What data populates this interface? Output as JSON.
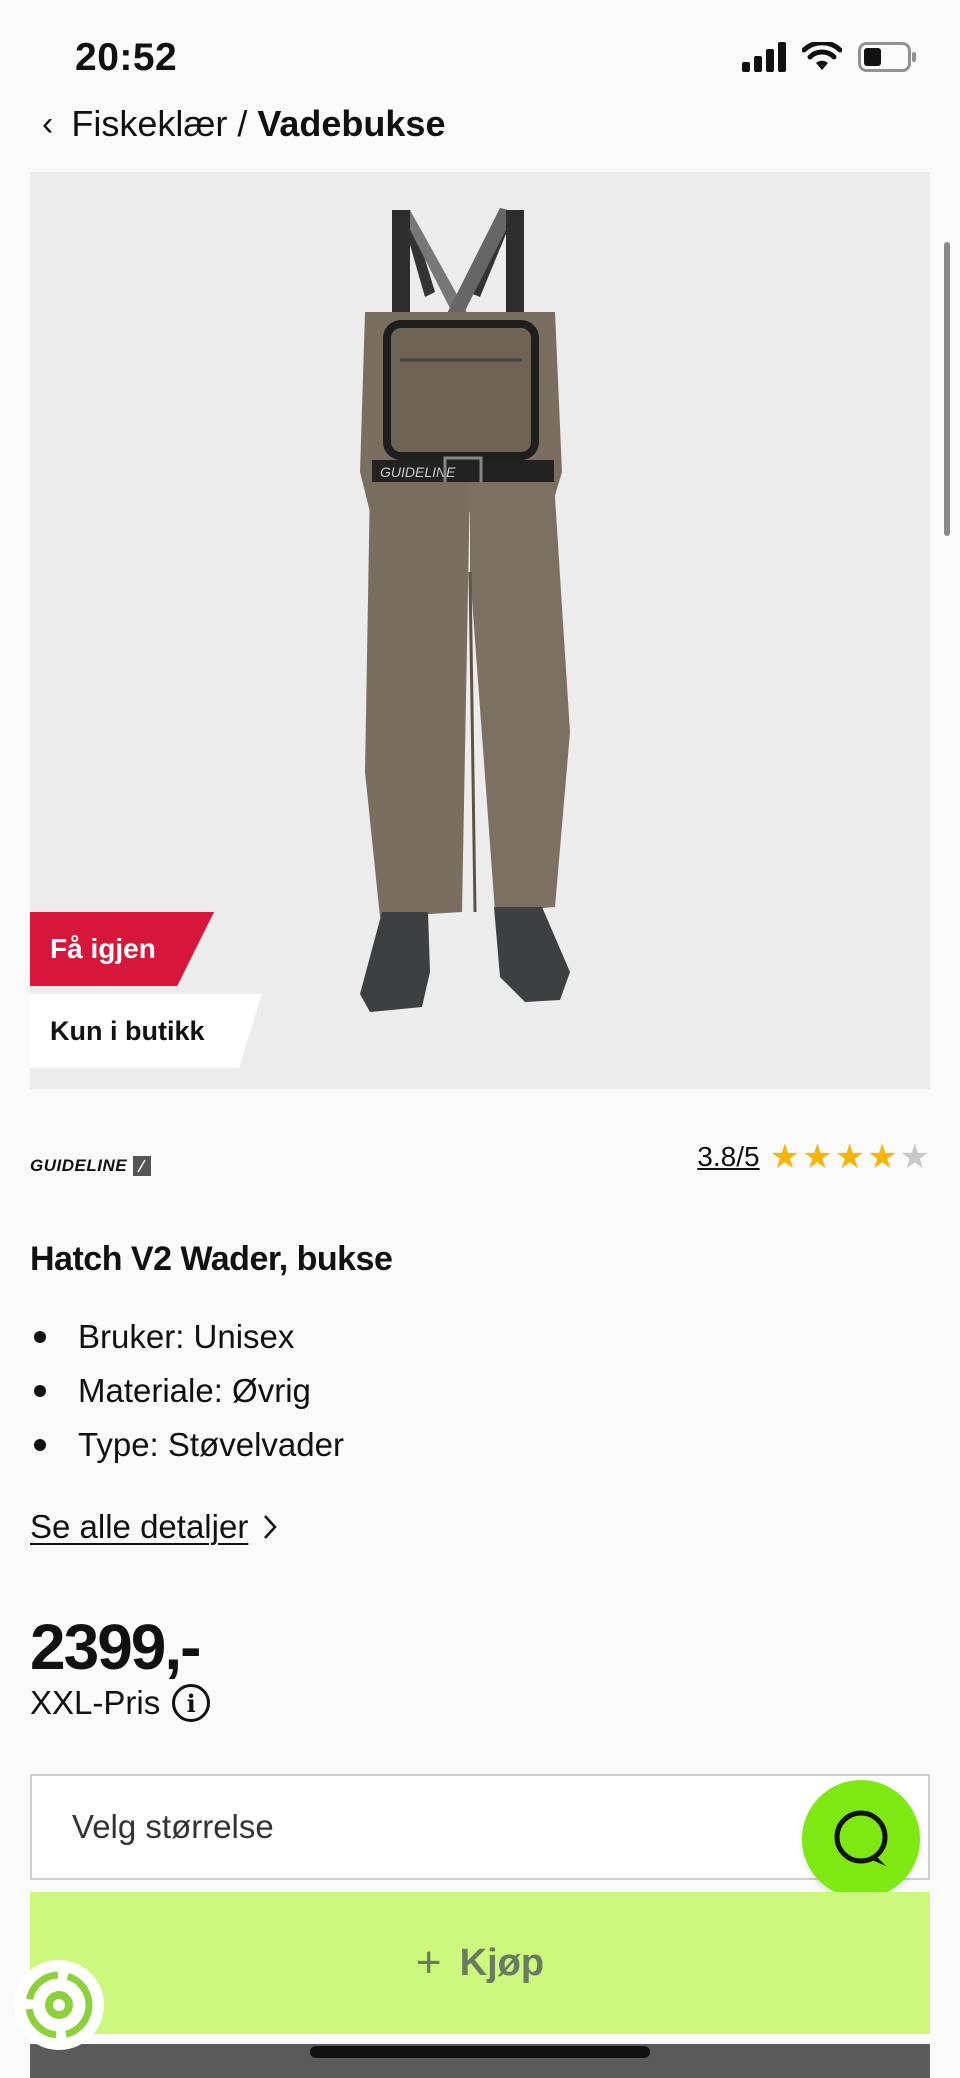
{
  "status_bar": {
    "time": "20:52",
    "battery_level": 0.4
  },
  "breadcrumb": {
    "parent": "Fiskeklær",
    "separator": "/",
    "current": "Vadebukse"
  },
  "product_image": {
    "badges": {
      "back_in_stock": "Få igjen",
      "store_only": "Kun i butikk"
    },
    "carousel": {
      "count": 3,
      "active": 0
    }
  },
  "product": {
    "brand": "GUIDELINE",
    "rating_text": "3.8/5",
    "rating_value": 3.8,
    "rating_max": 5,
    "title": "Hatch V2 Wader, bukse",
    "specs": [
      "Bruker: Unisex",
      "Materiale: Øvrig",
      "Type: Støvelvader"
    ],
    "details_link": "Se alle detaljer",
    "price": "2399,-",
    "price_label": "XXL-Pris"
  },
  "size_select": {
    "placeholder": "Velg størrelse"
  },
  "buy_button": {
    "label": "Kjøp"
  },
  "colors": {
    "accent_red": "#d6163a",
    "buy_green": "#cdf77d",
    "chat_green": "#7ee812",
    "star_gold": "#f5b50a"
  }
}
